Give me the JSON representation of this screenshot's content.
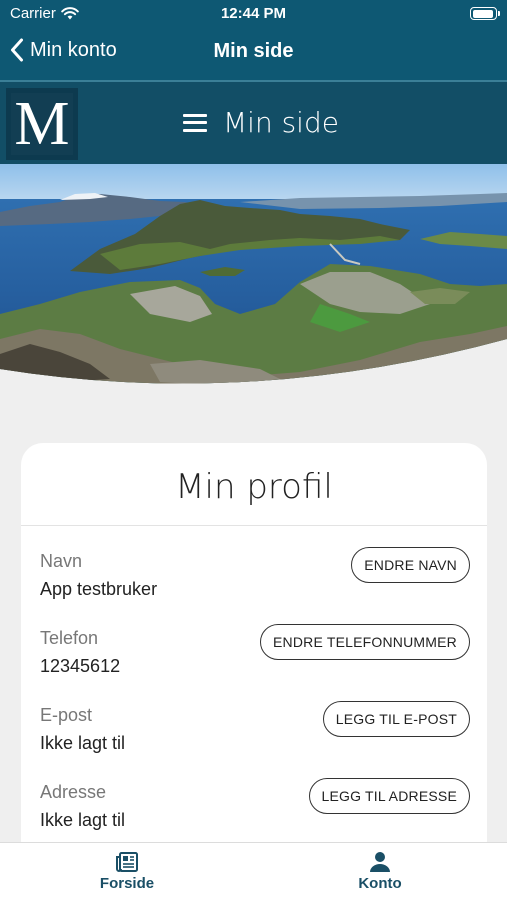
{
  "status": {
    "carrier": "Carrier",
    "time": "12:44 PM"
  },
  "nav": {
    "back_label": "Min konto",
    "title": "Min side"
  },
  "header": {
    "logo_letter": "M",
    "menu_title": "Min side"
  },
  "profile": {
    "title": "Min profil",
    "fields": [
      {
        "label": "Navn",
        "value": "App testbruker",
        "action": "ENDRE NAVN"
      },
      {
        "label": "Telefon",
        "value": "12345612",
        "action": "ENDRE TELEFONNUMMER"
      },
      {
        "label": "E-post",
        "value": "Ikke lagt til",
        "action": "LEGG TIL E-POST"
      },
      {
        "label": "Adresse",
        "value": "Ikke lagt til",
        "action": "LEGG TIL ADRESSE"
      }
    ]
  },
  "tabbar": {
    "items": [
      {
        "label": "Forside",
        "icon": "newspaper-icon"
      },
      {
        "label": "Konto",
        "icon": "person-icon"
      }
    ]
  },
  "colors": {
    "primary": "#0e5873",
    "header_dark": "#124e66",
    "tab_accent": "#1a4f66",
    "background": "#efefef"
  }
}
